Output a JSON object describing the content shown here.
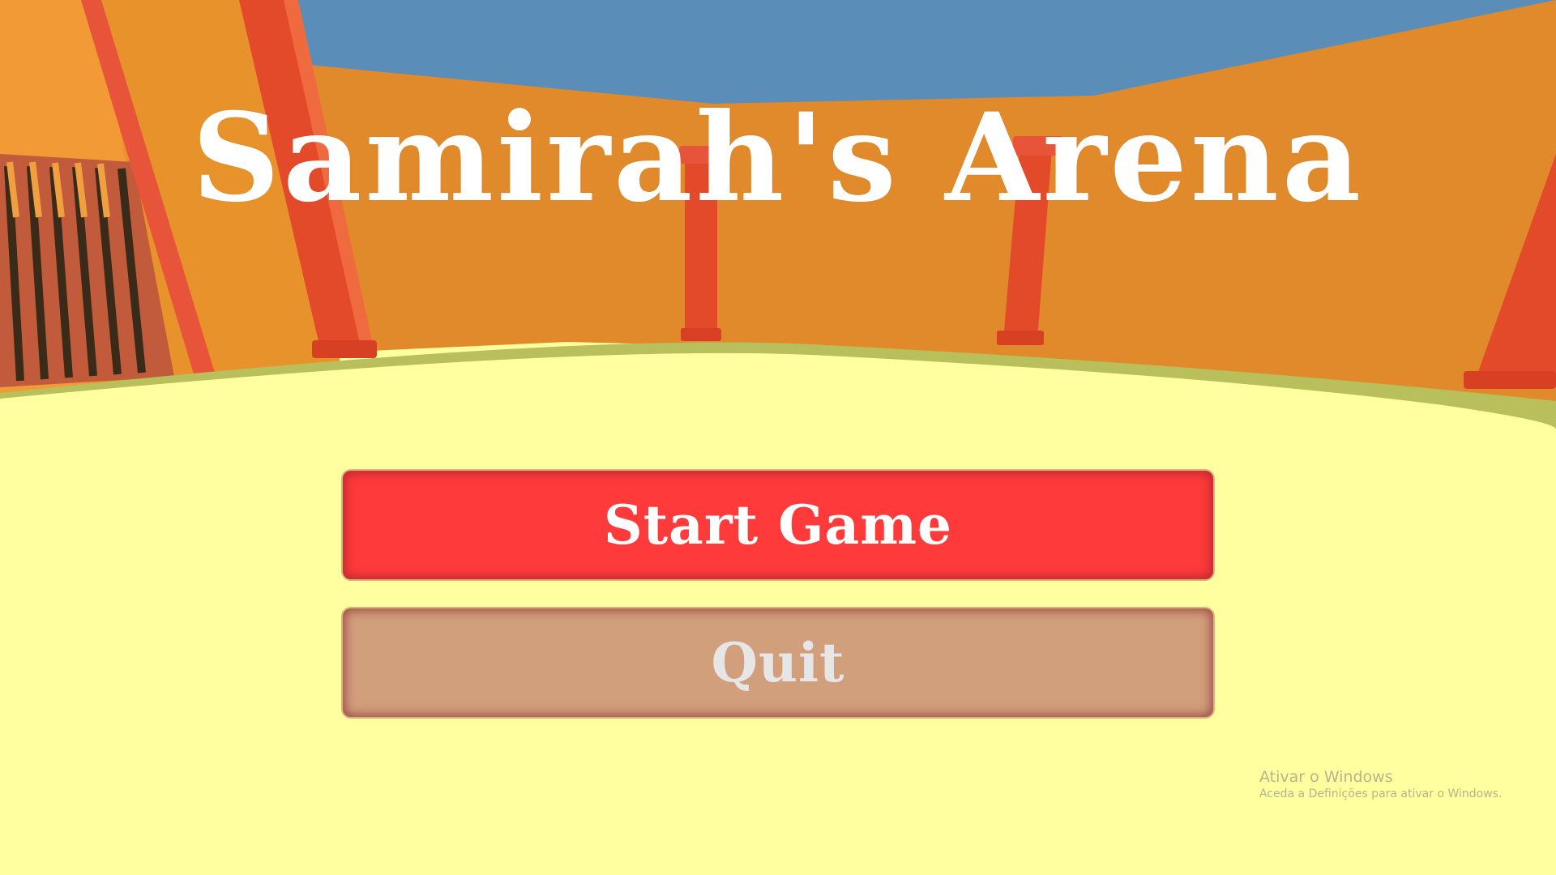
{
  "game": {
    "title": "Samirah's Arena"
  },
  "menu": {
    "start_label": "Start Game",
    "quit_label": "Quit"
  },
  "watermark": {
    "title": "Ativar o Windows",
    "subtitle": "Aceda a Definições para ativar o Windows."
  },
  "colors": {
    "sky": "#5b8db9",
    "wall": "#e08a2c",
    "pillar": "#e24a2a",
    "floor": "#ffff9f",
    "floor_edge": "#b9bf5a",
    "start_button": "#ff3a3a",
    "quit_button": "#d19f7b"
  }
}
